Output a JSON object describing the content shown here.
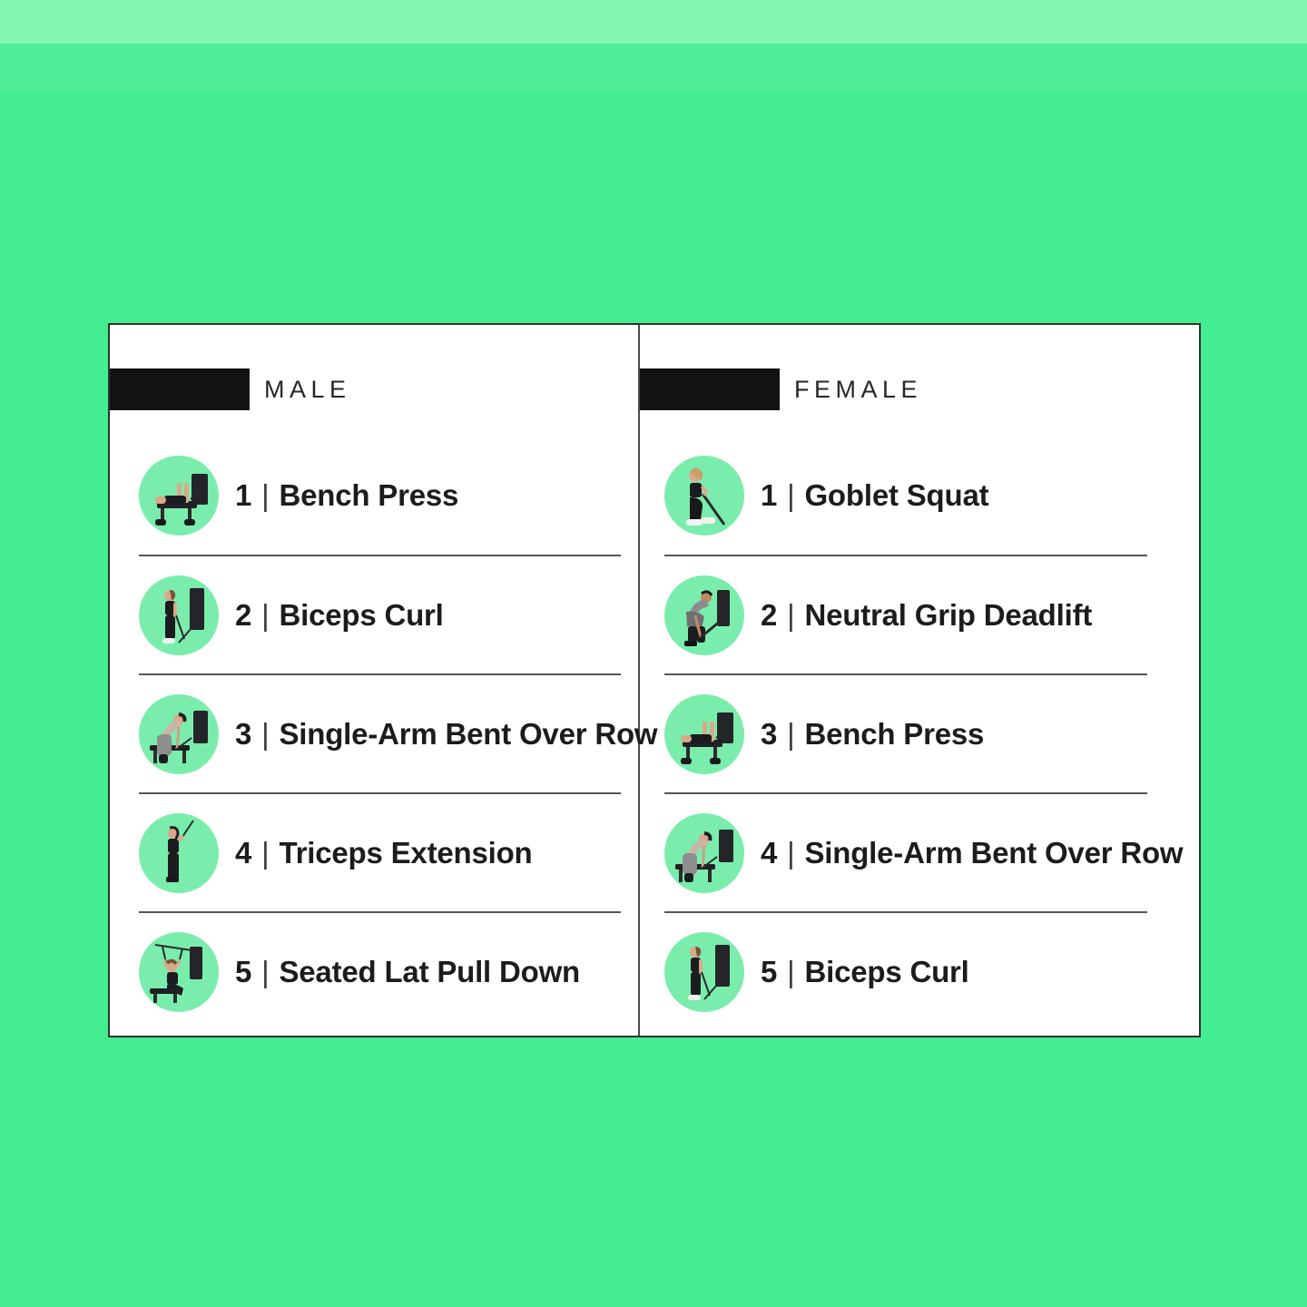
{
  "theme": {
    "background": "#44ee90",
    "band_top": "#82f7b2",
    "band_mid": "#4eee99",
    "card_background": "#ffffff",
    "card_border": "#2f3033",
    "header_block": "#131314",
    "thumb_circle": "#7aedad",
    "text": "#1b1c1e",
    "divider": "#54565a"
  },
  "columns": [
    {
      "id": "male",
      "label": "MALE",
      "items": [
        {
          "number": "1",
          "separator": "|",
          "name": "Bench Press",
          "icon": "bench-press-icon"
        },
        {
          "number": "2",
          "separator": "|",
          "name": "Biceps Curl",
          "icon": "biceps-curl-icon"
        },
        {
          "number": "3",
          "separator": "|",
          "name": "Single-Arm Bent Over Row",
          "icon": "bent-over-row-icon"
        },
        {
          "number": "4",
          "separator": "|",
          "name": "Triceps Extension",
          "icon": "triceps-extension-icon"
        },
        {
          "number": "5",
          "separator": "|",
          "name": "Seated Lat Pull Down",
          "icon": "lat-pull-down-icon"
        }
      ]
    },
    {
      "id": "female",
      "label": "FEMALE",
      "items": [
        {
          "number": "1",
          "separator": "|",
          "name": "Goblet Squat",
          "icon": "goblet-squat-icon"
        },
        {
          "number": "2",
          "separator": "|",
          "name": "Neutral Grip Deadlift",
          "icon": "deadlift-icon"
        },
        {
          "number": "3",
          "separator": "|",
          "name": "Bench Press",
          "icon": "bench-press-icon"
        },
        {
          "number": "4",
          "separator": "|",
          "name": "Single-Arm Bent Over Row",
          "icon": "bent-over-row-icon"
        },
        {
          "number": "5",
          "separator": "|",
          "name": "Biceps Curl",
          "icon": "biceps-curl-icon"
        }
      ]
    }
  ]
}
